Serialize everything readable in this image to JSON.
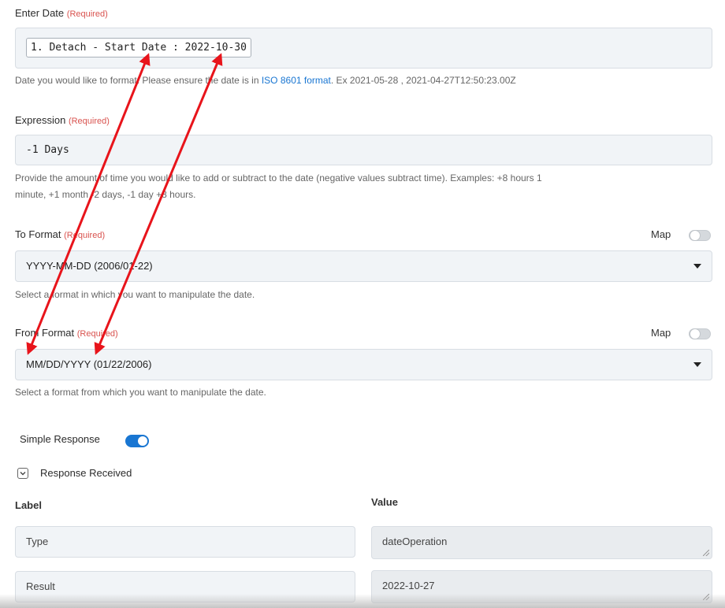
{
  "required_tag": "(Required)",
  "enter_date": {
    "label": "Enter Date",
    "chip_text": "1. Detach - Start Date : 2022-10-30",
    "help_before": "Date you would like to format. Please ensure the date is in ",
    "help_link": "ISO 8601 format",
    "help_after": ". Ex 2021-05-28 , 2021-04-27T12:50:23.00Z"
  },
  "expression": {
    "label": "Expression",
    "value": "-1 Days",
    "help_line1": "Provide the amount of time you would like to add or subtract to the date (negative values subtract time). Examples: +8 hours 1",
    "help_line2": "minute, +1 month -2 days, -1 day +8 hours."
  },
  "to_format": {
    "label": "To Format",
    "map_label": "Map",
    "selected": "YYYY-MM-DD (2006/01-22)",
    "help": "Select a format in which you want to manipulate the date."
  },
  "from_format": {
    "label": "From Format",
    "map_label": "Map",
    "selected": "MM/DD/YYYY (01/22/2006)",
    "help": "Select a format from which you want to manipulate the date."
  },
  "simple_response": {
    "label": "Simple Response"
  },
  "response_received": {
    "label": "Response Received"
  },
  "response_table": {
    "label_header": "Label",
    "value_header": "Value",
    "rows": [
      {
        "label": "Type",
        "value": "dateOperation"
      },
      {
        "label": "Result",
        "value": "2022-10-27"
      }
    ]
  },
  "colors": {
    "accent": "#1976d2",
    "required": "#d9534f",
    "annotation_arrow": "#e8141b"
  },
  "icons": {
    "dropdown": "caret-down-icon",
    "collapse": "chevron-down-icon",
    "resize": "resize-handle-icon"
  }
}
